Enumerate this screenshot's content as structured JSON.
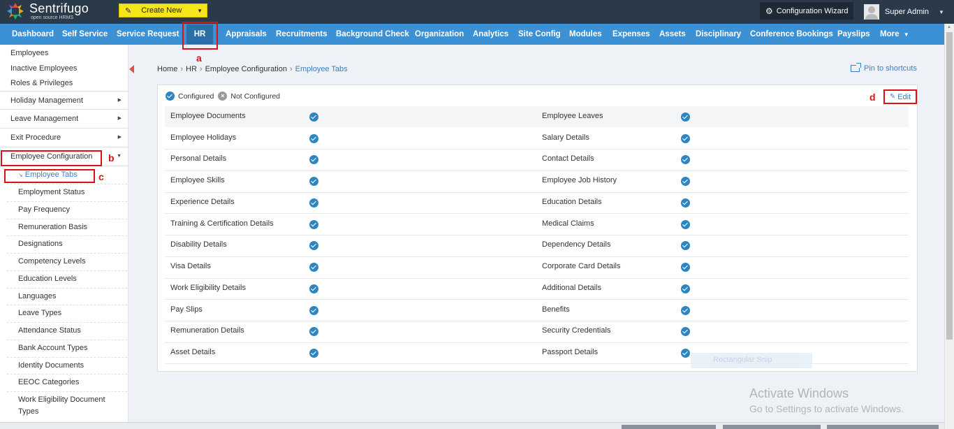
{
  "app": {
    "name": "Sentrifugo",
    "tagline": "open source HRMS"
  },
  "topbar": {
    "create_new": "Create New",
    "config_wizard": "Configuration Wizard",
    "user": "Super Admin"
  },
  "nav": [
    "Dashboard",
    "Self Service",
    "Service Request",
    "HR",
    "Appraisals",
    "Recruitments",
    "Background Check",
    "Organization",
    "Analytics",
    "Site Config",
    "Modules",
    "Expenses",
    "Assets",
    "Disciplinary",
    "Conference Bookings",
    "Payslips",
    "More"
  ],
  "sidebar": {
    "top_links": [
      "Employees",
      "Inactive Employees",
      "Roles & Privileges"
    ],
    "sections": [
      "Holiday Management",
      "Leave Management",
      "Exit Procedure",
      "Employee Configuration"
    ],
    "sub_items": [
      "Employee Tabs",
      "Employment Status",
      "Pay Frequency",
      "Remuneration Basis",
      "Designations",
      "Competency Levels",
      "Education Levels",
      "Languages",
      "Leave Types",
      "Attendance Status",
      "Bank Account Types",
      "Identity Documents",
      "EEOC Categories",
      "Work Eligibility Document",
      "Types"
    ]
  },
  "breadcrumb": [
    "Home",
    "HR",
    "Employee Configuration",
    "Employee Tabs"
  ],
  "pin_label": "Pin to shortcuts",
  "legend": {
    "configured": "Configured",
    "not_configured": "Not Configured"
  },
  "edit_label": "Edit",
  "tabs_table": [
    [
      "Employee Documents",
      "Employee Leaves"
    ],
    [
      "Employee Holidays",
      "Salary Details"
    ],
    [
      "Personal Details",
      "Contact Details"
    ],
    [
      "Employee Skills",
      "Employee Job History"
    ],
    [
      "Experience Details",
      "Education Details"
    ],
    [
      "Training & Certification Details",
      "Medical Claims"
    ],
    [
      "Disability Details",
      "Dependency Details"
    ],
    [
      "Visa Details",
      "Corporate Card Details"
    ],
    [
      "Work Eligibility Details",
      "Additional Details"
    ],
    [
      "Pay Slips",
      "Benefits"
    ],
    [
      "Remuneration Details",
      "Security Credentials"
    ],
    [
      "Asset Details",
      "Passport Details"
    ]
  ],
  "annotations": [
    "a",
    "b",
    "c",
    "d"
  ],
  "overlay": {
    "snip": "Rectangular Snip",
    "activate_title": "Activate Windows",
    "activate_sub": "Go to Settings to activate Windows."
  },
  "colors": {
    "nav": "#3c91d4",
    "topbar": "#2b3a4a",
    "create_new": "#f7e51c",
    "check": "#2e86c1",
    "annotation": "#dd1111"
  }
}
